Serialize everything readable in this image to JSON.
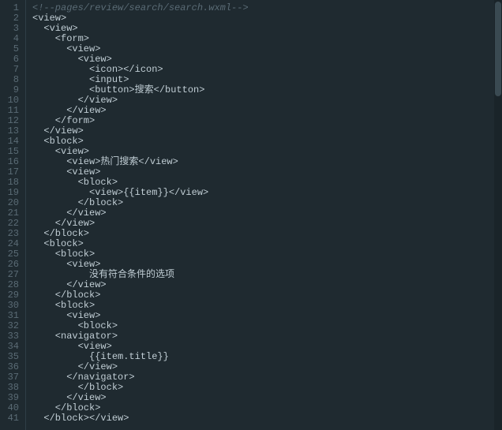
{
  "lines": [
    {
      "indent": 0,
      "cls": "cmt",
      "text": "<!--pages/review/search/search.wxml-->"
    },
    {
      "indent": 0,
      "cls": "tag",
      "text": "<view>"
    },
    {
      "indent": 1,
      "cls": "tag",
      "text": "<view>"
    },
    {
      "indent": 2,
      "cls": "tag",
      "text": "<form>"
    },
    {
      "indent": 3,
      "cls": "tag",
      "text": "<view>"
    },
    {
      "indent": 4,
      "cls": "tag",
      "text": "<view>"
    },
    {
      "indent": 5,
      "cls": "tag",
      "text": "<icon></icon>"
    },
    {
      "indent": 5,
      "cls": "tag",
      "text": "<input>"
    },
    {
      "indent": 5,
      "cls": "tag",
      "text": "<button>搜索</button>"
    },
    {
      "indent": 4,
      "cls": "tag",
      "text": "</view>"
    },
    {
      "indent": 3,
      "cls": "tag",
      "text": "</view>"
    },
    {
      "indent": 2,
      "cls": "tag",
      "text": "</form>"
    },
    {
      "indent": 1,
      "cls": "tag",
      "text": "</view>"
    },
    {
      "indent": 1,
      "cls": "tag",
      "text": "<block>"
    },
    {
      "indent": 2,
      "cls": "tag",
      "text": "<view>"
    },
    {
      "indent": 3,
      "cls": "tag",
      "text": "<view>热门搜索</view>"
    },
    {
      "indent": 3,
      "cls": "tag",
      "text": "<view>"
    },
    {
      "indent": 4,
      "cls": "tag",
      "text": "<block>"
    },
    {
      "indent": 5,
      "cls": "tag",
      "text": "<view>{{item}}</view>"
    },
    {
      "indent": 4,
      "cls": "tag",
      "text": "</block>"
    },
    {
      "indent": 3,
      "cls": "tag",
      "text": "</view>"
    },
    {
      "indent": 2,
      "cls": "tag",
      "text": "</view>"
    },
    {
      "indent": 1,
      "cls": "tag",
      "text": "</block>"
    },
    {
      "indent": 1,
      "cls": "tag",
      "text": "<block>"
    },
    {
      "indent": 2,
      "cls": "tag",
      "text": "<block>"
    },
    {
      "indent": 3,
      "cls": "tag",
      "text": "<view>"
    },
    {
      "indent": 5,
      "cls": "txt",
      "text": "没有符合条件的选项"
    },
    {
      "indent": 3,
      "cls": "tag",
      "text": "</view>"
    },
    {
      "indent": 2,
      "cls": "tag",
      "text": "</block>"
    },
    {
      "indent": 2,
      "cls": "tag",
      "text": "<block>"
    },
    {
      "indent": 3,
      "cls": "tag",
      "text": "<view>"
    },
    {
      "indent": 4,
      "cls": "tag",
      "text": "<block>"
    },
    {
      "indent": 2,
      "cls": "tag",
      "text": "<navigator>"
    },
    {
      "indent": 4,
      "cls": "tag",
      "text": "<view>"
    },
    {
      "indent": 5,
      "cls": "txt",
      "text": "{{item.title}}"
    },
    {
      "indent": 4,
      "cls": "tag",
      "text": "</view>"
    },
    {
      "indent": 3,
      "cls": "tag",
      "text": "</navigator>"
    },
    {
      "indent": 4,
      "cls": "tag",
      "text": "</block>"
    },
    {
      "indent": 3,
      "cls": "tag",
      "text": "</view>"
    },
    {
      "indent": 2,
      "cls": "tag",
      "text": "</block>"
    },
    {
      "indent": 1,
      "cls": "tag",
      "text": "</block></view>"
    }
  ]
}
